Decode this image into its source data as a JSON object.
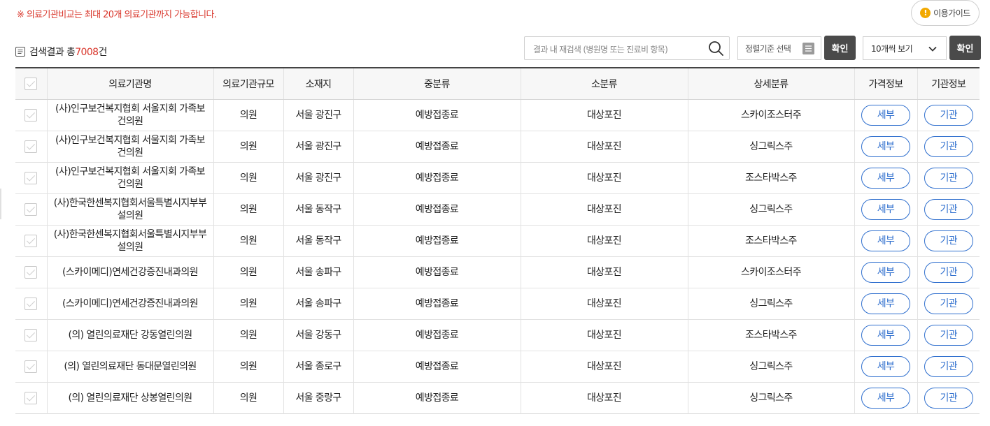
{
  "notice": "※ 의료기관비교는 최대 20개 의료기관까지 가능합니다.",
  "guide": {
    "label": "이용가이드",
    "icon": "info-icon"
  },
  "result": {
    "prefix": "검색결과 총",
    "count": "7008",
    "suffix": "건"
  },
  "search": {
    "placeholder": "결과 내 재검색 (병원명 또는 진료비 항목)",
    "value": ""
  },
  "sort": {
    "label": "정렬기준 선택"
  },
  "per_page": {
    "label": "10개씩 보기"
  },
  "confirm_label": "확인",
  "colors": {
    "accent": "#d9372c",
    "link": "#2f6fce",
    "dark_button": "#4a4a4a"
  },
  "table": {
    "headers": [
      "의료기관명",
      "의료기관규모",
      "소재지",
      "중분류",
      "소분류",
      "상세분류",
      "가격정보",
      "기관정보"
    ],
    "detail_label": "세부",
    "org_label": "기관",
    "rows": [
      {
        "name": "(사)인구보건복지협회 서울지회 가족보건의원",
        "scale": "의원",
        "location": "서울 광진구",
        "mid": "예방접종료",
        "small": "대상포진",
        "detail": "스카이조스터주"
      },
      {
        "name": "(사)인구보건복지협회 서울지회 가족보건의원",
        "scale": "의원",
        "location": "서울 광진구",
        "mid": "예방접종료",
        "small": "대상포진",
        "detail": "싱그릭스주"
      },
      {
        "name": "(사)인구보건복지협회 서울지회 가족보건의원",
        "scale": "의원",
        "location": "서울 광진구",
        "mid": "예방접종료",
        "small": "대상포진",
        "detail": "조스타박스주"
      },
      {
        "name": "(사)한국한센복지협회서울특별시지부부설의원",
        "scale": "의원",
        "location": "서울 동작구",
        "mid": "예방접종료",
        "small": "대상포진",
        "detail": "싱그릭스주"
      },
      {
        "name": "(사)한국한센복지협회서울특별시지부부설의원",
        "scale": "의원",
        "location": "서울 동작구",
        "mid": "예방접종료",
        "small": "대상포진",
        "detail": "조스타박스주"
      },
      {
        "name": "(스카이메디)연세건강증진내과의원",
        "scale": "의원",
        "location": "서울 송파구",
        "mid": "예방접종료",
        "small": "대상포진",
        "detail": "스카이조스터주"
      },
      {
        "name": "(스카이메디)연세건강증진내과의원",
        "scale": "의원",
        "location": "서울 송파구",
        "mid": "예방접종료",
        "small": "대상포진",
        "detail": "싱그릭스주"
      },
      {
        "name": "(의) 열린의료재단 강동열린의원",
        "scale": "의원",
        "location": "서울 강동구",
        "mid": "예방접종료",
        "small": "대상포진",
        "detail": "조스타박스주"
      },
      {
        "name": "(의) 열린의료재단 동대문열린의원",
        "scale": "의원",
        "location": "서울 종로구",
        "mid": "예방접종료",
        "small": "대상포진",
        "detail": "싱그릭스주"
      },
      {
        "name": "(의) 열린의료재단 상봉열린의원",
        "scale": "의원",
        "location": "서울 중랑구",
        "mid": "예방접종료",
        "small": "대상포진",
        "detail": "싱그릭스주"
      }
    ]
  }
}
